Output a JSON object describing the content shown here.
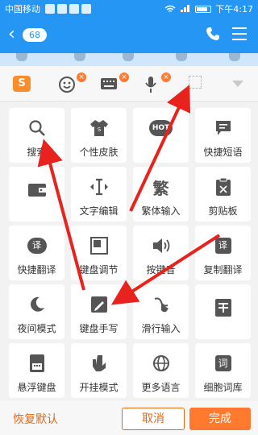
{
  "status_bar": {
    "carrier": "中国移动",
    "clock": "下午4:17"
  },
  "nav": {
    "back_badge": "68"
  },
  "grid": [
    {
      "label": "搜索",
      "icon": "search-icon"
    },
    {
      "label": "个性皮肤",
      "icon": "shirt-icon"
    },
    {
      "label": "HOT",
      "icon": "hot-badge-icon",
      "is_badge": true
    },
    {
      "label": "快捷短语",
      "icon": "chat-bubble-icon"
    },
    {
      "label": "",
      "icon": "wallet-icon"
    },
    {
      "label": "文字编辑",
      "icon": "text-cursor-icon"
    },
    {
      "label": "繁体输入",
      "icon_text": "繁"
    },
    {
      "label": "剪贴板",
      "icon": "clipboard-icon"
    },
    {
      "label": "快捷翻译",
      "icon_text": "译"
    },
    {
      "label": "键盘调节",
      "icon": "resize-icon"
    },
    {
      "label": "按键音",
      "icon": "speaker-icon"
    },
    {
      "label": "复制翻译",
      "icon_text": "译"
    },
    {
      "label": "夜间模式",
      "icon": "moon-icon"
    },
    {
      "label": "键盘手写",
      "icon": "pen-icon"
    },
    {
      "label": "滑行输入",
      "icon": "swipe-icon"
    },
    {
      "label": "",
      "icon": "ticket-icon"
    },
    {
      "label": "悬浮键盘",
      "icon": "float-keyboard-icon"
    },
    {
      "label": "开挂模式",
      "icon": "cheat-mode-icon"
    },
    {
      "label": "更多语言",
      "icon": "globe-icon"
    },
    {
      "label": "细胞词库",
      "icon_text": "词"
    }
  ],
  "bottom": {
    "restore": "恢复默认",
    "cancel": "取消",
    "done": "完成"
  },
  "colors": {
    "brand_blue": "#2596f3",
    "accent_orange": "#ff7a2e",
    "arrow_red": "#e8231e"
  }
}
